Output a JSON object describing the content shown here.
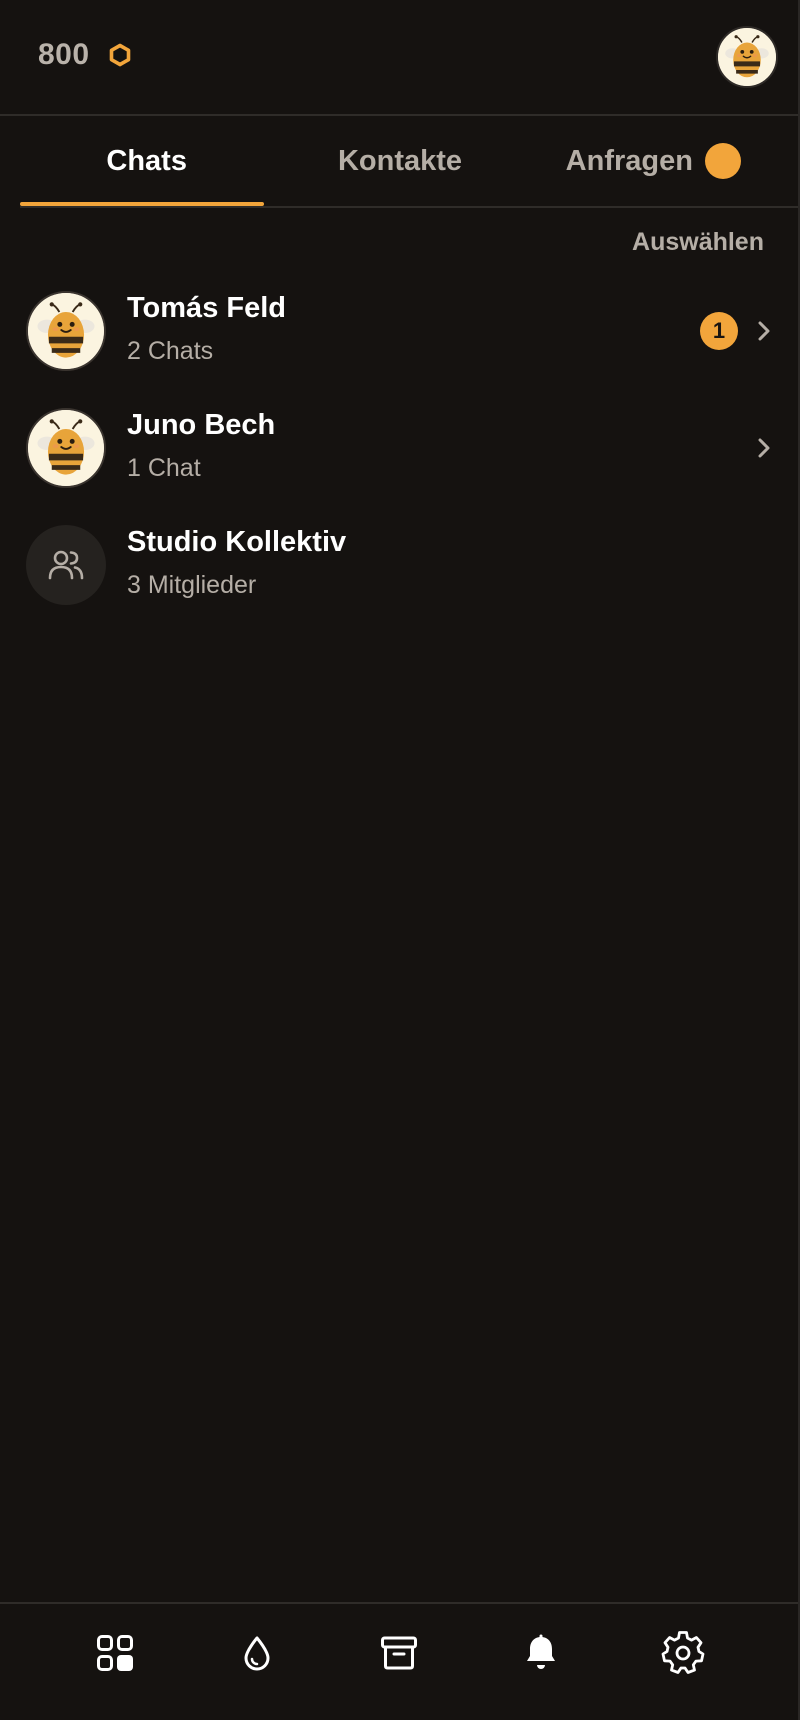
{
  "header": {
    "coins": "800",
    "coin_icon": "honeycomb-icon",
    "avatar_icon": "bee-avatar-icon"
  },
  "tabs": [
    {
      "label": "Chats",
      "active": true
    },
    {
      "label": "Kontakte",
      "active": false
    },
    {
      "label": "Anfragen",
      "active": false,
      "dot": true
    }
  ],
  "list": {
    "select_label": "Auswählen",
    "rows": [
      {
        "title": "Tomás Feld",
        "subtitle": "2 Chats",
        "badge": "1",
        "avatar": "bee-avatar-icon",
        "chevron": true
      },
      {
        "title": "Juno Bech",
        "subtitle": "1 Chat",
        "avatar": "bee-avatar-icon",
        "chevron": true
      },
      {
        "title": "Studio Kollektiv",
        "subtitle": "3 Mitglieder",
        "avatar": "group-icon",
        "chevron": false
      }
    ]
  },
  "bottom_nav": [
    {
      "icon": "grid-icon"
    },
    {
      "icon": "drop-icon"
    },
    {
      "icon": "archive-icon"
    },
    {
      "icon": "bell-icon"
    },
    {
      "icon": "gear-icon"
    }
  ],
  "colors": {
    "background": "#151210",
    "accent": "#f2a53b",
    "muted_text": "#b5aea6",
    "divider": "#2f2c29"
  }
}
